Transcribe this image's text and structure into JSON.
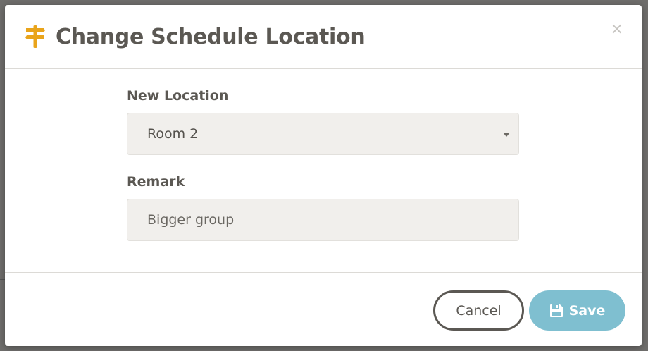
{
  "modal": {
    "title": "Change Schedule Location",
    "close_symbol": "×",
    "header_icon": "signpost-icon",
    "fields": {
      "location_label": "New Location",
      "location_value": "Room 2",
      "remark_label": "Remark",
      "remark_value": "Bigger group"
    },
    "buttons": {
      "cancel_label": "Cancel",
      "save_label": "Save"
    }
  },
  "colors": {
    "accent_icon": "#e9a41b",
    "save_button": "#7fbfd0",
    "title_text": "#5b5853",
    "field_bg": "#f1efec"
  }
}
